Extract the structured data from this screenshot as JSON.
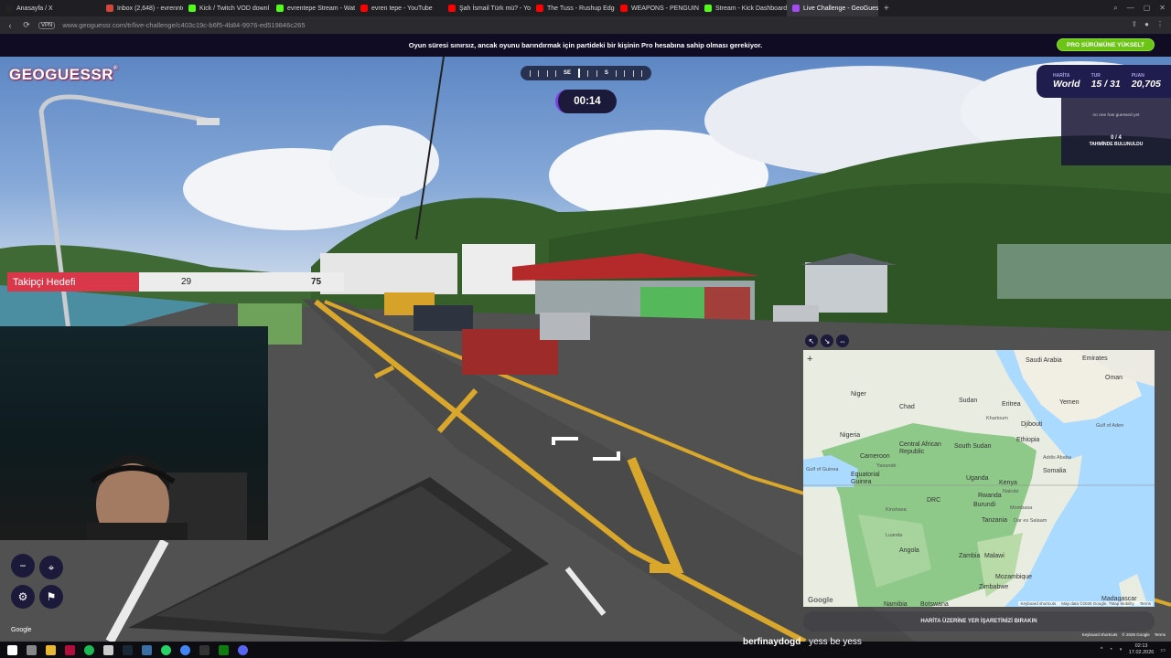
{
  "browser": {
    "tabs": [
      {
        "label": "Anasayfa / X",
        "color": "#222222"
      },
      {
        "label": "Inbox (2,648) - evrenntep",
        "color": "#d44638"
      },
      {
        "label": "Kick / Twitch VOD downl",
        "color": "#53fc18"
      },
      {
        "label": "evrentepe Stream - Watc",
        "color": "#53fc18"
      },
      {
        "label": "evren tepe - YouTube",
        "color": "#ff0000"
      },
      {
        "label": "Şah İsmail Türk mü? - Yo",
        "color": "#ff0000"
      },
      {
        "label": "The Tuss - Rushup Edge",
        "color": "#ff0000"
      },
      {
        "label": "WEAPONS - PENGUIN - E",
        "color": "#ff0000"
      },
      {
        "label": "Stream - Kick Dashboard",
        "color": "#53fc18"
      },
      {
        "label": "Live Challenge - GeoGues",
        "color": "#a34cf5"
      }
    ],
    "active_tab_index": 9,
    "new_tab": "+",
    "url": "www.geoguessr.com/tr/live-challenge/c403c19c-b6f5-4b84-9976-ed519846c265",
    "vpn_label": "VPN"
  },
  "promo": {
    "text": "Oyun süresi sınırsız, ancak oyunu barındırmak için partideki bir kişinin Pro hesabına sahip olması gerekiyor.",
    "button": "PRO SÜRÜMÜNE YÜKSELT",
    "button_color": "#6cc417"
  },
  "game": {
    "logo": "GEOGUESSR",
    "compass": {
      "left": "SE",
      "right": "S"
    },
    "timer": "00:14",
    "status": {
      "map_label": "HARİTA",
      "map_value": "World",
      "round_label": "TUR",
      "round_value": "15 / 31",
      "score_label": "PUAN",
      "score_value": "20,705"
    },
    "players": {
      "no_guess": "no one has guessed yet",
      "found_count": "0 / 4",
      "found_label": "TAHMİNDE BULUNULDU"
    },
    "guess_button": "HARİTA ÜZERİNE YER İŞARETİNİZİ BIRAKIN",
    "google": "Google",
    "footer": [
      "Keyboard shortcuts",
      "© 2026 Google",
      "Terms"
    ]
  },
  "goal": {
    "label": "Takipçi Hedefi",
    "current": "29",
    "target": "75",
    "progress": 0.39,
    "color": "#d9384b"
  },
  "map": {
    "zoom_in": "+",
    "labels": [
      "Saudi Arabia",
      "Emirates",
      "Oman",
      "Niger",
      "Chad",
      "Sudan",
      "Eritrea",
      "Yemen",
      "Djibouti",
      "Nigeria",
      "South Sudan",
      "Ethiopia",
      "Central African Republic",
      "Cameroon",
      "Equatorial Guinea",
      "Uganda",
      "Somalia",
      "Kenya",
      "DRC",
      "Rwanda",
      "Burundi",
      "Tanzania",
      "Angola",
      "Zambia",
      "Malawi",
      "Mozambique",
      "Zimbabwe",
      "Namibia",
      "Botswana",
      "Madagascar"
    ],
    "small_labels": [
      "Khartoum",
      "Addis Ababa",
      "Yaoundé",
      "Gulf of Guinea",
      "Luanda",
      "Mombasa",
      "Dar es Salaam",
      "Nairobi",
      "Kinshasa",
      "Gulf of Aden"
    ],
    "google": "Google",
    "attribution": [
      "Keyboard shortcuts",
      "Map data ©2026 Google, TMap Mobility",
      "Terms"
    ]
  },
  "chat": {
    "user": "berfinaydogd",
    "message": "yess be yess"
  },
  "taskbar": {
    "time": "02:13",
    "date": "17.02.2026"
  }
}
